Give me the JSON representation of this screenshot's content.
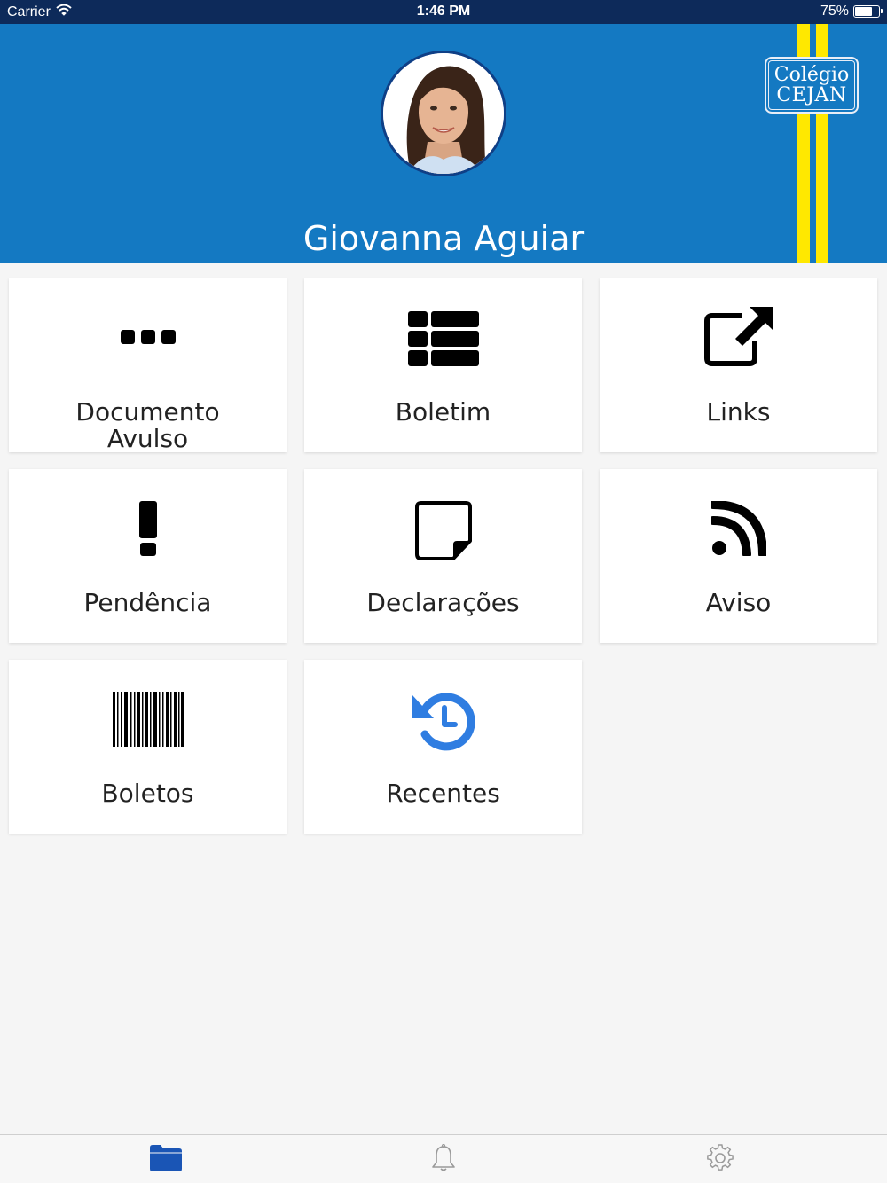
{
  "status_bar": {
    "carrier": "Carrier",
    "time": "1:46 PM",
    "battery_percent": "75%",
    "battery_level": 0.75,
    "wifi_icon": "wifi-icon"
  },
  "header": {
    "user_name": "Giovanna Aguiar",
    "logo": {
      "line1": "Colégio",
      "line2": "CEJAN"
    },
    "colors": {
      "background": "#1479c2",
      "stripes": "#ffe800",
      "status_bar": "#0d2a5a"
    }
  },
  "menu": {
    "items": [
      {
        "label_line1": "Documento",
        "label_line2": "Avulso",
        "icon": "ellipsis-icon"
      },
      {
        "label": "Boletim",
        "icon": "list-icon"
      },
      {
        "label": "Links",
        "icon": "external-link-icon"
      },
      {
        "label": "Pendência",
        "icon": "exclamation-icon"
      },
      {
        "label": "Declarações",
        "icon": "sticky-note-icon"
      },
      {
        "label": "Aviso",
        "icon": "rss-icon"
      },
      {
        "label": "Boletos",
        "icon": "barcode-icon"
      },
      {
        "label": "Recentes",
        "icon": "history-icon",
        "icon_color": "#2f7de1"
      }
    ]
  },
  "tabbar": {
    "tabs": [
      {
        "icon": "folder-icon",
        "active": true,
        "color": "#1a55b5"
      },
      {
        "icon": "bell-icon",
        "active": false,
        "color": "#9a9a9a"
      },
      {
        "icon": "gear-icon",
        "active": false,
        "color": "#9a9a9a"
      }
    ]
  }
}
